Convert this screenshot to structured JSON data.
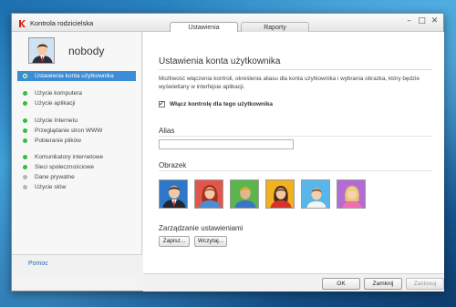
{
  "window": {
    "title": "Kontrola rodzicielska",
    "minimize_glyph": "–",
    "maximize_glyph": "□",
    "close_glyph": "✕"
  },
  "tabs": [
    {
      "label": "Ustawienia",
      "active": true
    },
    {
      "label": "Raporty",
      "active": false
    }
  ],
  "user": {
    "name": "nobody"
  },
  "sidebar": {
    "items": [
      {
        "label": "Ustawienia konta użytkownika",
        "active": true,
        "dot_color": "#2fbf3f"
      },
      {
        "label": "Użycie komputera",
        "active": false,
        "dot_color": "#2fbf3f"
      },
      {
        "label": "Użycie aplikacji",
        "active": false,
        "dot_color": "#2fbf3f"
      },
      {
        "label": "Użycie Internetu",
        "active": false,
        "dot_color": "#2fbf3f"
      },
      {
        "label": "Przeglądanie stron WWW",
        "active": false,
        "dot_color": "#2fbf3f"
      },
      {
        "label": "Pobieranie plików",
        "active": false,
        "dot_color": "#2fbf3f"
      },
      {
        "label": "Komunikatory internetowe",
        "active": false,
        "dot_color": "#2fbf3f"
      },
      {
        "label": "Sieci społecznościowe",
        "active": false,
        "dot_color": "#2fbf3f"
      },
      {
        "label": "Dane prywatne",
        "active": false,
        "dot_color": "#b5b5b5"
      },
      {
        "label": "Użycie słów",
        "active": false,
        "dot_color": "#b5b5b5"
      }
    ],
    "help_label": "Pomoc"
  },
  "content": {
    "title": "Ustawienia konta użytkownika",
    "description": "Możliwość włączenia kontroli, określenia aliasu dla konta użytkownika i wybrania obrazka, który będzie wyświetlany w interfejsie aplikacji.",
    "enable_checkbox": {
      "label": "Włącz kontrolę dla tego użytkownika",
      "checked": true,
      "check_glyph": "✓"
    },
    "alias": {
      "label": "Alias",
      "value": ""
    },
    "image": {
      "label": "Obrazek",
      "options": [
        {
          "name": "man-suit",
          "bg": "#2f78c9"
        },
        {
          "name": "woman-redhead",
          "bg": "#e2564a"
        },
        {
          "name": "boy-blue-shirt",
          "bg": "#5ab64c"
        },
        {
          "name": "girl-red-shirt",
          "bg": "#f1b221"
        },
        {
          "name": "child-white-shirt",
          "bg": "#58b7e8"
        },
        {
          "name": "girl-pink",
          "bg": "#b36cd3"
        }
      ]
    },
    "manage": {
      "label": "Zarządzanie ustawieniami",
      "save_label": "Zapisz...",
      "load_label": "Wczytaj..."
    }
  },
  "footer": {
    "ok_label": "OK",
    "close_label": "Zamknij",
    "apply_label": "Zastosuj"
  }
}
